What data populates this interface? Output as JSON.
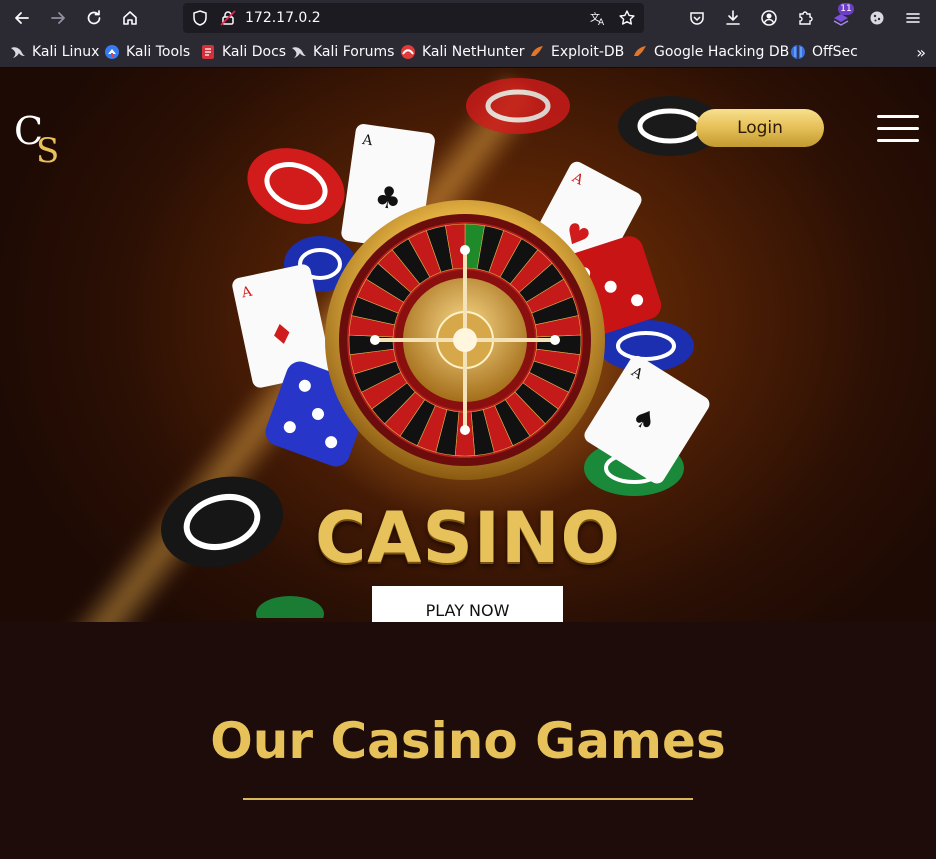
{
  "browser": {
    "url": "172.17.0.2",
    "extension_badge": "11",
    "bookmarks": [
      {
        "label": "Kali Linux",
        "icon": "kali-dragon-icon"
      },
      {
        "label": "Kali Tools",
        "icon": "kali-tools-icon"
      },
      {
        "label": "Kali Docs",
        "icon": "kali-docs-icon"
      },
      {
        "label": "Kali Forums",
        "icon": "kali-dragon-icon"
      },
      {
        "label": "Kali NetHunter",
        "icon": "nethunter-icon"
      },
      {
        "label": "Exploit-DB",
        "icon": "exploit-db-icon"
      },
      {
        "label": "Google Hacking DB",
        "icon": "ghdb-icon"
      },
      {
        "label": "OffSec",
        "icon": "offsec-icon"
      }
    ]
  },
  "site": {
    "logo_text": "CS",
    "login_label": "Login",
    "hero_word": "CASINO",
    "play_label": "PLAY NOW",
    "section_title": "Our Casino Games"
  },
  "colors": {
    "gold": "#e7c25a",
    "dark_bg": "#1d0c0a",
    "chrome": "#2b2a33"
  }
}
